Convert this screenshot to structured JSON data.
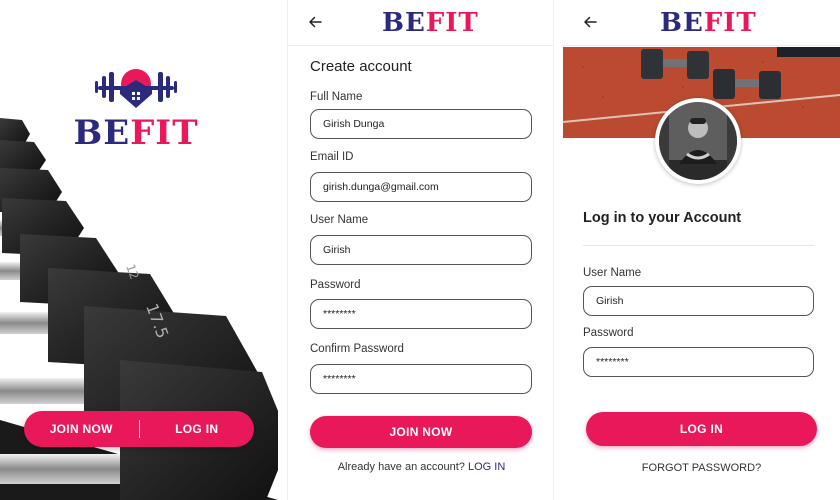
{
  "colors": {
    "brand_navy": "#2b2a7c",
    "brand_pink": "#e8185a",
    "court_red": "#b5452c"
  },
  "brand": {
    "part1": "BE",
    "part2": "FIT"
  },
  "splash": {
    "join_label": "JOIN NOW",
    "login_label": "LOG IN",
    "icons": [
      "barbell-house-logo-icon",
      "dumbbell-rack-photo"
    ]
  },
  "signup": {
    "title": "Create account",
    "fields": [
      {
        "label": "Full Name",
        "value": "Girish Dunga"
      },
      {
        "label": "Email ID",
        "value": "girish.dunga@gmail.com"
      },
      {
        "label": "User Name",
        "value": "Girish"
      },
      {
        "label": "Password",
        "value": "********"
      },
      {
        "label": "Confirm Password",
        "value": "********"
      }
    ],
    "submit_label": "JOIN NOW",
    "footer_text": "Already have an account?",
    "footer_link": "LOG IN"
  },
  "login": {
    "title": "Log in to your Account",
    "fields": [
      {
        "label": "User Name",
        "value": "Girish"
      },
      {
        "label": "Password",
        "value": "********"
      }
    ],
    "submit_label": "LOG IN",
    "forgot_label": "FORGOT PASSWORD?"
  }
}
